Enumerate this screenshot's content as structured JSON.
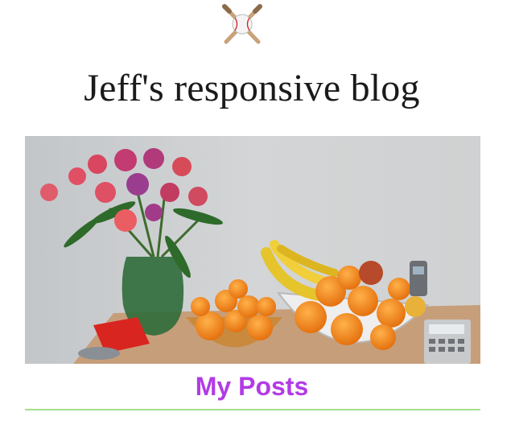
{
  "site": {
    "logo_icon": "baseball-bats-icon",
    "title": "Jeff's responsive blog"
  },
  "hero": {
    "subject": "fruit-bowls-and-flowers-photo"
  },
  "posts_section": {
    "heading": "My Posts",
    "heading_color": "#b23be6",
    "divider_color": "#a3e08a"
  }
}
